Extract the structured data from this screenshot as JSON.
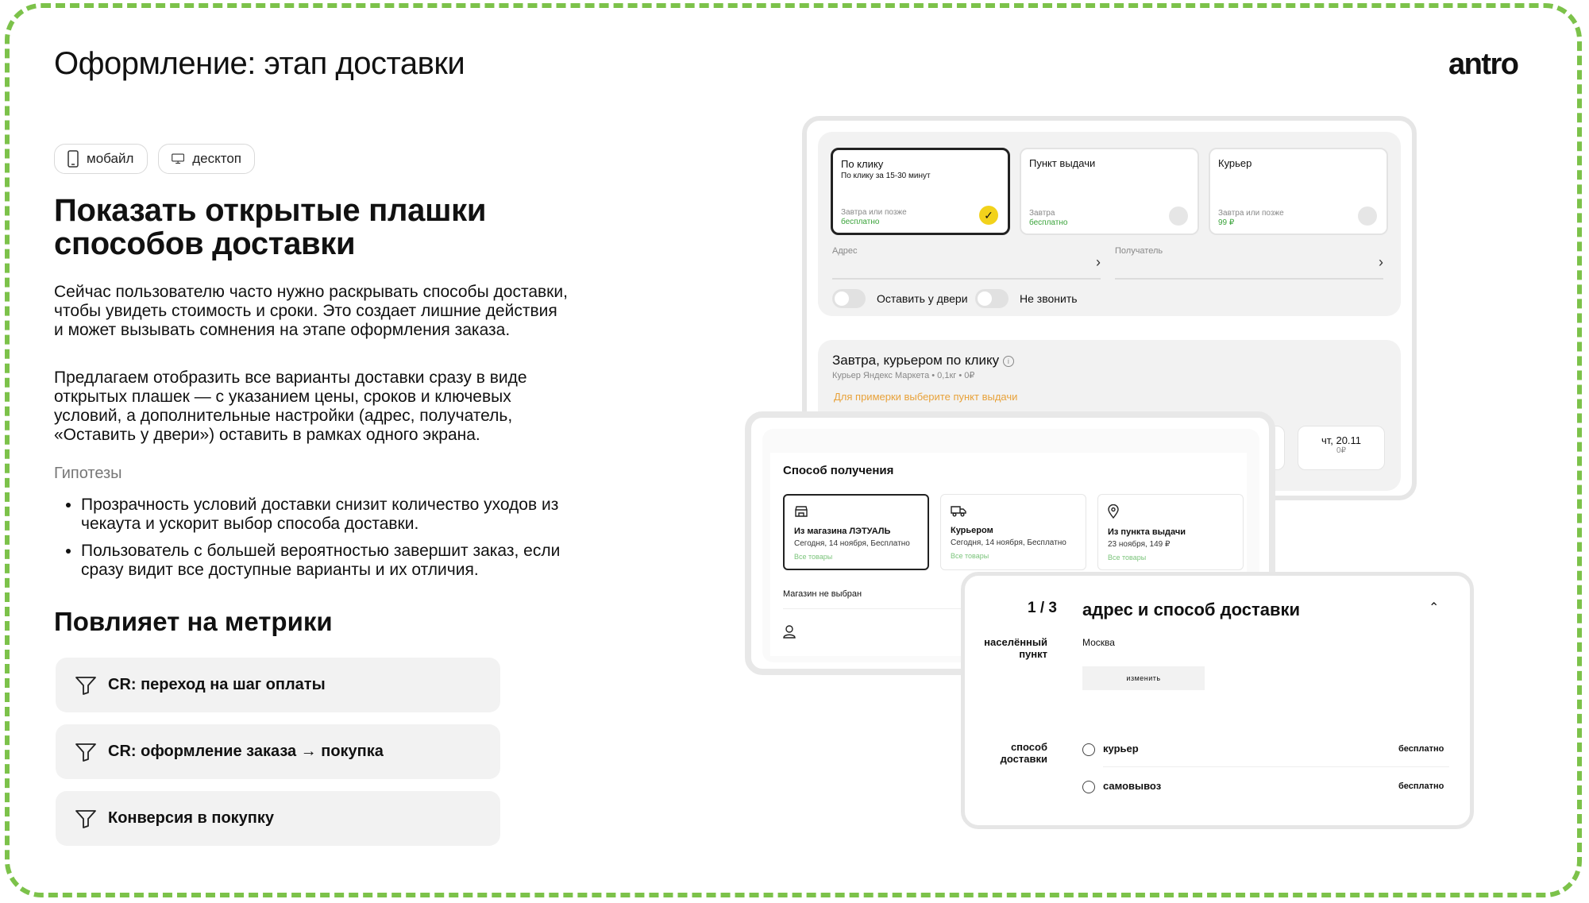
{
  "header": {
    "title": "Оформление: этап доставки",
    "logo": "antro"
  },
  "platform_chips": [
    {
      "icon": "mobile-icon",
      "label": "мобайл"
    },
    {
      "icon": "desktop-icon",
      "label": "десктоп"
    }
  ],
  "heading": "Показать открытые плашки способов доставки",
  "paragraphs": [
    "Сейчас пользователю часто нужно раскрывать способы доставки, чтобы увидеть стоимость и сроки. Это создает лишние действия и может вызывать сомнения на этапе оформления заказа.",
    "Предлагаем отобразить все варианты доставки сразу в виде открытых плашек — с указанием цены, сроков и ключевых условий, а дополнительные настройки (адрес, получатель, «Оставить у двери») оставить в рамках одного экрана."
  ],
  "hypotheses": {
    "title": "Гипотезы",
    "items": [
      "Прозрачность условий доставки снизит количество уходов из чекаута и ускорит выбор способа доставки.",
      "Пользователь с большей вероятностью завершит заказ, если сразу видит все доступные варианты и их отличия."
    ]
  },
  "metrics": {
    "title": "Повлияет на метрики",
    "items": [
      "CR: переход на шаг оплаты",
      "CR: оформление заказа → покупка",
      "Конверсия в покупку"
    ]
  },
  "mock1": {
    "options": [
      {
        "title": "По клику",
        "subtitle": "По клику за 15-30 минут",
        "date": "Завтра или позже",
        "price": "бесплатно",
        "selected": true
      },
      {
        "title": "Пункт выдачи",
        "subtitle": "",
        "date": "Завтра",
        "price": "бесплатно",
        "selected": false
      },
      {
        "title": "Курьер",
        "subtitle": "",
        "date": "Завтра или позже",
        "price": "99 ₽",
        "selected": false
      }
    ],
    "address_label": "Адрес",
    "recipient_label": "Получатель",
    "toggle1": "Оставить у двери",
    "toggle2": "Не звонить",
    "delivery_title": "Завтра, курьером по клику",
    "delivery_sub": "Курьер Яндекс Маркета • 0,1кг • 0₽",
    "delivery_note": "Для примерки выберите пункт выдачи",
    "slot_date": "чт, 20.11",
    "slot_price": "0₽"
  },
  "mock2": {
    "title": "Способ получения",
    "options": [
      {
        "icon": "store-icon",
        "name": "Из магазина ЛЭТУАЛЬ",
        "date": "Сегодня, 14 ноября, Бесплатно",
        "link": "Все товары",
        "selected": true
      },
      {
        "icon": "truck-icon",
        "name": "Курьером",
        "date": "Сегодня, 14 ноября, Бесплатно",
        "link": "Все товары",
        "selected": false
      },
      {
        "icon": "pin-icon",
        "name": "Из пункта выдачи",
        "date": "23 ноября, 149 ₽",
        "link": "Все товары",
        "selected": false
      }
    ],
    "store_status": "Магазин не выбран"
  },
  "mock3": {
    "step": "1 / 3",
    "title": "адрес и способ доставки",
    "city_label": "населённый пункт",
    "city_value": "Москва",
    "change_button": "изменить",
    "method_label": "способ доставки",
    "methods": [
      {
        "name": "курьер",
        "price": "бесплатно"
      },
      {
        "name": "самовывоз",
        "price": "бесплатно"
      }
    ]
  },
  "colors": {
    "frame": "#7cc24a",
    "accent_yellow": "#f2d21b",
    "green_text": "#3aa33a",
    "orange_note": "#e8a23a"
  }
}
